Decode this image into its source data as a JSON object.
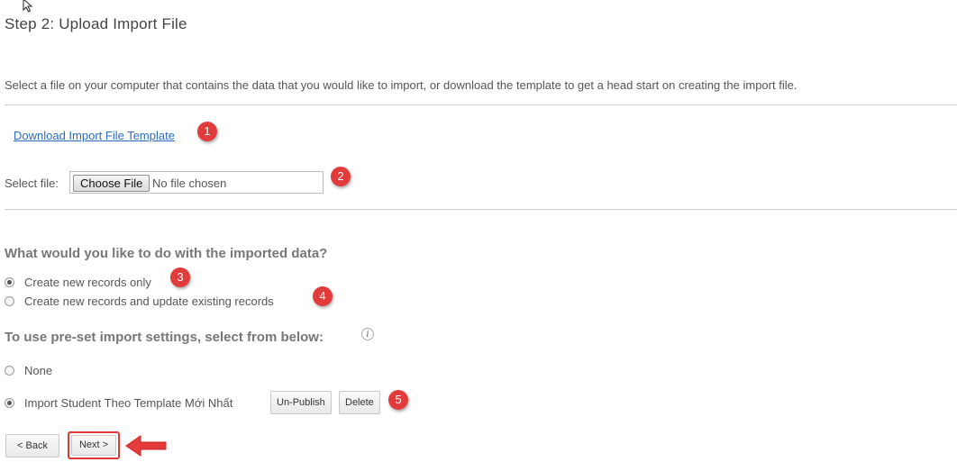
{
  "step": {
    "title": "Step 2: Upload Import File"
  },
  "description": "Select a file on your computer that contains the data that you would like to import, or download the template to get a head start on creating the import file.",
  "download_link": "Download Import File Template",
  "file_select": {
    "label": "Select file:",
    "button": "Choose File",
    "status": "No file chosen"
  },
  "import_mode": {
    "question": "What would you like to do with the imported data?",
    "options": [
      {
        "label": "Create new records only",
        "checked": true
      },
      {
        "label": "Create new records and update existing records",
        "checked": false
      }
    ]
  },
  "presets": {
    "heading": "To use pre-set import settings, select from below:",
    "info_icon": "info-icon",
    "options": [
      {
        "label": "None",
        "checked": false
      },
      {
        "label": "Import Student Theo Template Mới Nhất",
        "checked": true
      }
    ],
    "unpublish": "Un-Publish",
    "delete": "Delete"
  },
  "nav": {
    "back": "< Back",
    "next": "Next >"
  },
  "badges": [
    "1",
    "2",
    "3",
    "4",
    "5"
  ],
  "accent_colors": {
    "annotation": "#e23b3b",
    "link": "#2a6bc4"
  }
}
